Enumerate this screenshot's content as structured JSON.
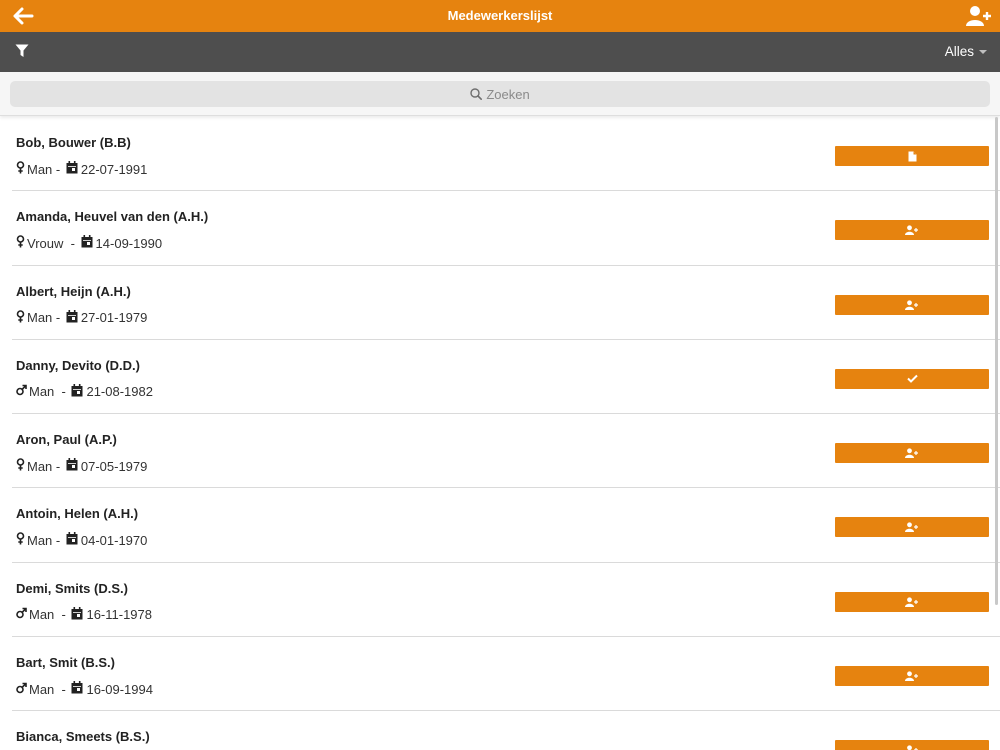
{
  "header": {
    "title": "Medewerkerslijst",
    "back_icon": "arrow-left-icon",
    "add_icon": "user-plus-icon"
  },
  "toolbar": {
    "filter_icon": "filter-icon",
    "filter_value": "Alles"
  },
  "search": {
    "placeholder": "Zoeken",
    "icon": "search-icon"
  },
  "colors": {
    "accent": "#e6830f",
    "toolbar": "#4e4e4e",
    "search_bg": "#e3e3e3"
  },
  "employees": [
    {
      "name": "Bob, Bouwer (B.B)",
      "gender_icon": "female-icon",
      "gender_label": "Man",
      "sep": " - ",
      "date": "22-07-1991",
      "action_icon": "document-icon"
    },
    {
      "name": "Amanda, Heuvel van den (A.H.)",
      "gender_icon": "female-icon",
      "gender_label": "Vrouw",
      "sep": "  - ",
      "date": "14-09-1990",
      "action_icon": "user-plus-icon"
    },
    {
      "name": "Albert, Heijn (A.H.)",
      "gender_icon": "female-icon",
      "gender_label": "Man",
      "sep": " - ",
      "date": "27-01-1979",
      "action_icon": "user-plus-icon"
    },
    {
      "name": "Danny, Devito (D.D.)",
      "gender_icon": "male-icon",
      "gender_label": "Man",
      "sep": "  - ",
      "date": "21-08-1982",
      "action_icon": "check-icon"
    },
    {
      "name": "Aron, Paul (A.P.)",
      "gender_icon": "female-icon",
      "gender_label": "Man",
      "sep": " - ",
      "date": "07-05-1979",
      "action_icon": "user-plus-icon"
    },
    {
      "name": "Antoin, Helen (A.H.)",
      "gender_icon": "female-icon",
      "gender_label": "Man",
      "sep": " - ",
      "date": "04-01-1970",
      "action_icon": "user-plus-icon"
    },
    {
      "name": "Demi, Smits (D.S.)",
      "gender_icon": "male-icon",
      "gender_label": "Man",
      "sep": "  - ",
      "date": "16-11-1978",
      "action_icon": "user-plus-icon"
    },
    {
      "name": "Bart, Smit (B.S.)",
      "gender_icon": "male-icon",
      "gender_label": "Man",
      "sep": "  - ",
      "date": "16-09-1994",
      "action_icon": "user-plus-icon"
    },
    {
      "name": "Bianca, Smeets (B.S.)",
      "gender_icon": "female-icon",
      "gender_label": "",
      "sep": "",
      "date": "",
      "action_icon": "user-plus-icon"
    }
  ]
}
